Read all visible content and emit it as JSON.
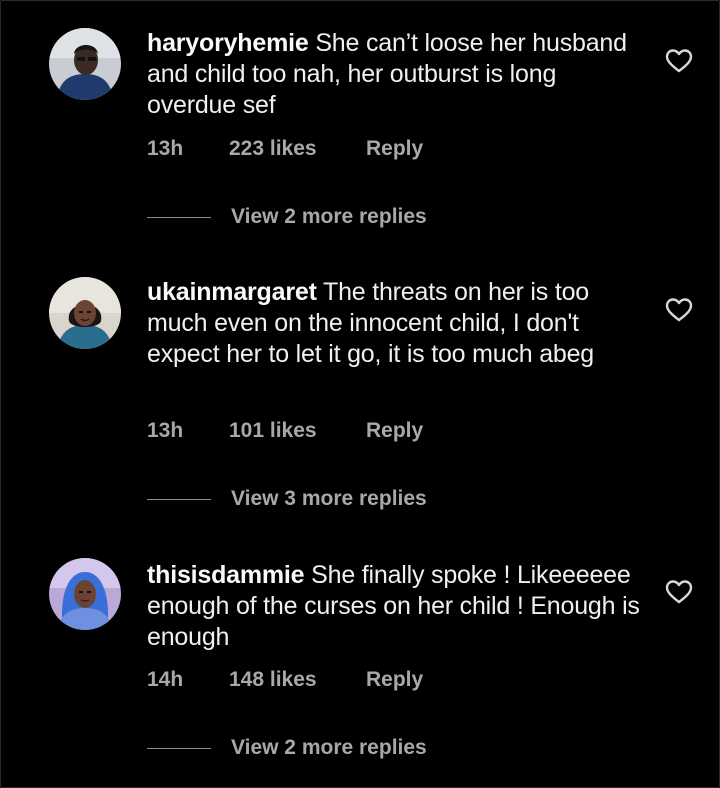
{
  "comments": [
    {
      "username": "haryoryhemie",
      "text": "She can’t loose her husband and child too nah, her outburst is long overdue sef",
      "time": "13h",
      "likes": "223 likes",
      "reply": "Reply",
      "view_replies": "View 2 more replies",
      "avatar": "man-portrait-avatar"
    },
    {
      "username": "ukainmargaret",
      "text": "The threats on her is too much even on the innocent child, I don't expect her to let it go, it is too much abeg",
      "time": "13h",
      "likes": "101 likes",
      "reply": "Reply",
      "view_replies": "View 3 more replies",
      "avatar": "woman-portrait-avatar"
    },
    {
      "username": "thisisdammie",
      "text": "She finally spoke ! Likeeeeee enough of the curses on her child ! Enough is enough",
      "time": "14h",
      "likes": "148 likes",
      "reply": "Reply",
      "view_replies": "View 2 more replies",
      "avatar": "woman-blue-hair-avatar"
    }
  ],
  "colors": {
    "background": "#000000",
    "text": "#f0f0f0",
    "secondary": "#a8a8a8"
  },
  "icons": {
    "like": "heart-outline-icon"
  }
}
